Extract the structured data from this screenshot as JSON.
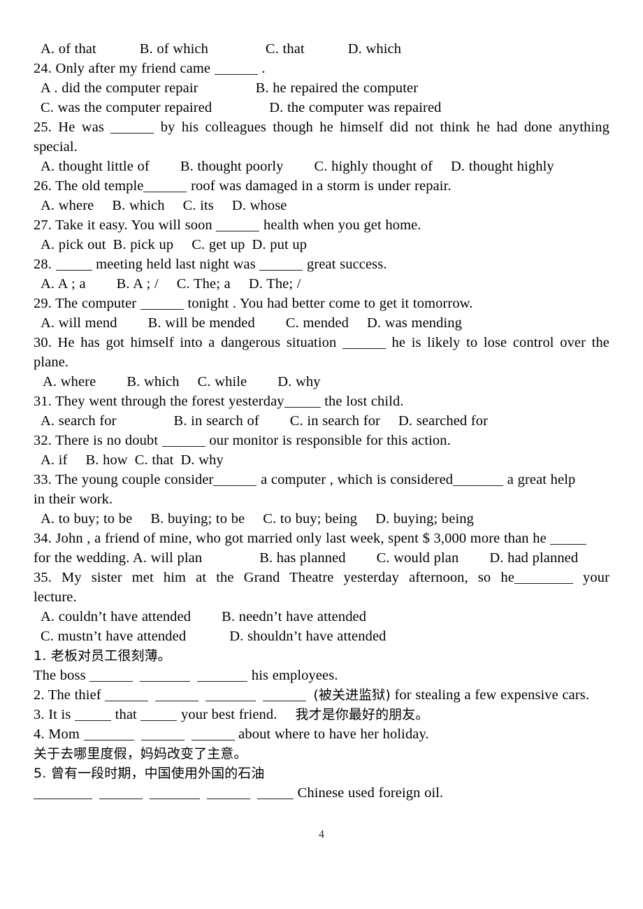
{
  "document": {
    "page_number": "4",
    "type": "english-exam-worksheet"
  },
  "multiple_choice": {
    "q23_options": {
      "a": "A. of that",
      "b": "B. of which",
      "c": "C. that",
      "d": "D. which"
    },
    "q24": {
      "stem_before": "24. Only after my friend came ",
      "stem_after": " ."
    },
    "q24_options": {
      "a": "A . did the computer repair",
      "b": "B. he repaired the computer",
      "c": "C. was the computer repaired",
      "d": "D. the computer was repaired"
    },
    "q25": {
      "stem_before": "25. He was ",
      "stem_after": " by his colleagues though he himself did not think he had done anything",
      "stem_line2": "special."
    },
    "q25_options": {
      "a": "A. thought little of",
      "b": "B. thought poorly",
      "c": "C. highly thought of",
      "d": "D. thought highly"
    },
    "q26": {
      "stem_before": "26. The old temple",
      "stem_after": " roof was damaged in a storm is under repair."
    },
    "q26_options": {
      "a": "A. where",
      "b": "B. which",
      "c": "C. its",
      "d": "D. whose"
    },
    "q27": {
      "stem_before": "27. Take it easy. You will soon ",
      "stem_after": " health when you get home."
    },
    "q27_options": {
      "a": "A. pick out",
      "b": "B. pick up",
      "c": "C. get up",
      "d": "D. put up"
    },
    "q28": {
      "stem_before": "28. ",
      "stem_middle": " meeting held last night was ",
      "stem_after": " great success."
    },
    "q28_options": {
      "a": "A. A ; a",
      "b": "B. A ; /",
      "c": "C. The; a",
      "d": "D. The; /"
    },
    "q29": {
      "stem_before": "29. The computer ",
      "stem_after": " tonight . You had better come to get it tomorrow."
    },
    "q29_options": {
      "a": "A. will mend",
      "b": "B. will be mended",
      "c": "C. mended",
      "d": "D. was mending"
    },
    "q30": {
      "stem_before": "30. He has got himself into a dangerous situation ",
      "stem_after": " he is likely to lose control over the",
      "stem_line2": "plane."
    },
    "q30_options": {
      "a": "A. where",
      "b": "B. which",
      "c": "C. while",
      "d": "D. why"
    },
    "q31": {
      "stem_before": "31. They went through the forest yesterday",
      "stem_after": " the lost child."
    },
    "q31_options": {
      "a": "A. search for",
      "b": "B. in search of",
      "c": "C. in search for",
      "d": "D. searched for"
    },
    "q32": {
      "stem_before": "32. There is no doubt ",
      "stem_after": " our monitor is responsible for this action."
    },
    "q32_options": {
      "a": "A. if",
      "b": "B. how",
      "c": "C. that",
      "d": "D. why"
    },
    "q33": {
      "stem_before": "33. The young couple consider",
      "stem_middle": " a computer , which is considered",
      "stem_after": " a great help",
      "stem_line2": "in their work."
    },
    "q33_options": {
      "a": "A. to buy; to be",
      "b": "B. buying; to be",
      "c": "C. to buy; being",
      "d": "D. buying; being"
    },
    "q34": {
      "stem_before": "34. John , a friend of mine, who got married only last week, spent $ 3,000 more than he ",
      "stem_line2_before": "for the wedding. A. will plan"
    },
    "q34_options": {
      "a": "A. will plan",
      "b": "B. has planned",
      "c": "C. would plan",
      "d": "D. had planned"
    },
    "q35": {
      "stem_before": "35. My sister met him at the Grand Theatre yesterday afternoon, so he",
      "stem_after": " your",
      "stem_line2": "lecture."
    },
    "q35_options": {
      "a": "A. couldn’t have attended",
      "b": "B. needn’t have attended",
      "c": "C. mustn’t have attended",
      "d": "D. shouldn’t have attended"
    }
  },
  "translation": {
    "t1": {
      "prompt": "1. 老板对员工很刻薄。",
      "answer_before": "The boss ",
      "answer_after": " his employees."
    },
    "t2": {
      "before": "2. The thief ",
      "hint": "(被关进监狱)",
      "after": " for stealing a few expensive cars."
    },
    "t3": {
      "before": "3. It is ",
      "middle": " that ",
      "after": " your best friend.",
      "chinese": "我才是你最好的朋友。"
    },
    "t4": {
      "before": "4. Mom ",
      "after": " about where to have her holiday.",
      "chinese": "关于去哪里度假，妈妈改变了主意。"
    },
    "t5": {
      "prompt": "5. 曾有一段时期，中国使用外国的石油",
      "answer_after": " Chinese used foreign oil."
    }
  }
}
